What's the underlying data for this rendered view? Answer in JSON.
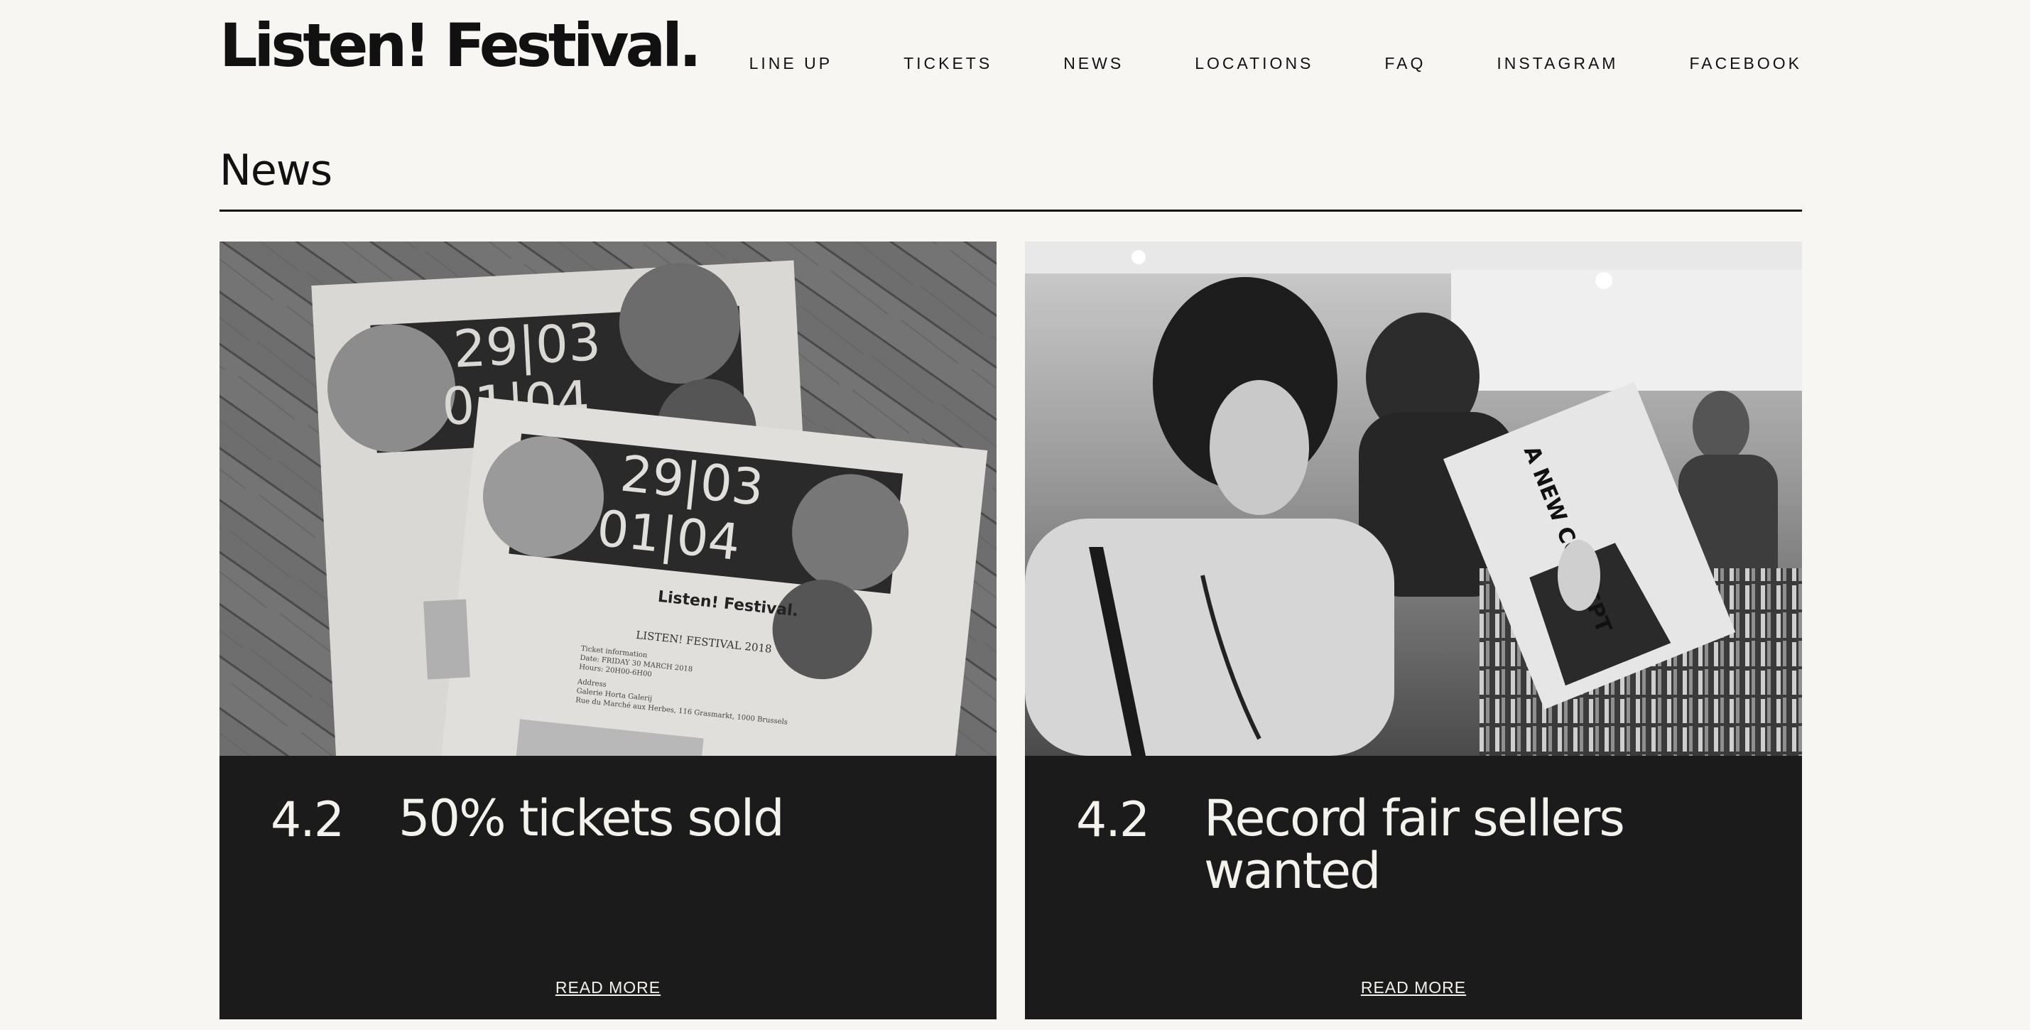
{
  "header": {
    "logo": "Listen! Festival.",
    "nav": [
      "LINE UP",
      "TICKETS",
      "NEWS",
      "LOCATIONS",
      "FAQ",
      "INSTAGRAM",
      "FACEBOOK"
    ]
  },
  "main": {
    "section_title": "News",
    "cards": [
      {
        "date": "4.2",
        "title": "50% tickets sold",
        "read_more": "READ MORE",
        "image": {
          "flyer_dates": [
            "29|03",
            "01|04"
          ],
          "flyer_brand": "Listen! Festival.",
          "flyer_heading": "LISTEN! FESTIVAL 2018",
          "flyer_lines": [
            "Ticket information",
            "Date: FRIDAY 30 MARCH 2018",
            "Hours: 20H00-6H00",
            "Address",
            "Galerie Horta Galerij",
            "Rue du Marché aux Herbes, 116 Grasmarkt, 1000 Brussels"
          ]
        }
      },
      {
        "date": "4.2",
        "title": "Record fair sellers wanted",
        "read_more": "READ MORE",
        "image": {
          "record_text": "A NEW CONCEPT"
        }
      }
    ]
  }
}
